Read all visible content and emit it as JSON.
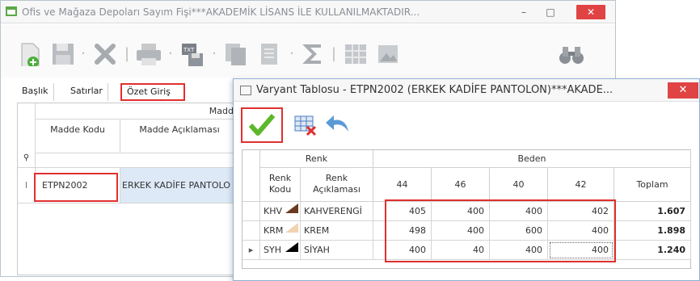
{
  "main_window": {
    "title": "Ofis ve Mağaza Depoları Sayım Fişi***AKADEMİK LİSANS İLE KULLANILMAKTADIR...",
    "minimize": "–",
    "maximize": "□",
    "close": "✕"
  },
  "tabs": {
    "baslik": "Başlık",
    "satirlar": "Satırlar",
    "ozet": "Özet Giriş"
  },
  "main_grid": {
    "group_header": "Madd",
    "col_code": "Madde Kodu",
    "col_desc": "Madde Açıklaması",
    "filter_glyph": "⚲",
    "row_marker": "I",
    "row": {
      "code": "ETPN2002",
      "desc": "ERKEK KADİFE PANTOLO"
    }
  },
  "dialog": {
    "title": "Varyant Tablosu - ETPN2002 (ERKEK KADİFE PANTOLON)***AKADE...",
    "close": "✕",
    "group_renk": "Renk",
    "group_beden": "Beden",
    "col_renk_kodu": "Renk Kodu",
    "col_renk_aciklama": "Renk Açıklaması",
    "sizes": [
      "44",
      "46",
      "40",
      "42"
    ],
    "col_toplam": "Toplam",
    "rows": [
      {
        "code": "KHV",
        "desc": "KAHVERENGİ",
        "color": "#6b3a1f",
        "values": [
          "405",
          "400",
          "400",
          "402"
        ],
        "total": "1.607",
        "marker": ""
      },
      {
        "code": "KRM",
        "desc": "KREM",
        "color": "#f3d2b0",
        "values": [
          "498",
          "400",
          "600",
          "400"
        ],
        "total": "1.898",
        "marker": ""
      },
      {
        "code": "SYH",
        "desc": "SİYAH",
        "color": "#000000",
        "values": [
          "400",
          "40",
          "400",
          "400"
        ],
        "total": "1.240",
        "marker": "▸"
      }
    ]
  },
  "colors": {
    "highlight": "#e0302e",
    "close_red": "#e04343",
    "confirm_green": "#5cb82a"
  }
}
